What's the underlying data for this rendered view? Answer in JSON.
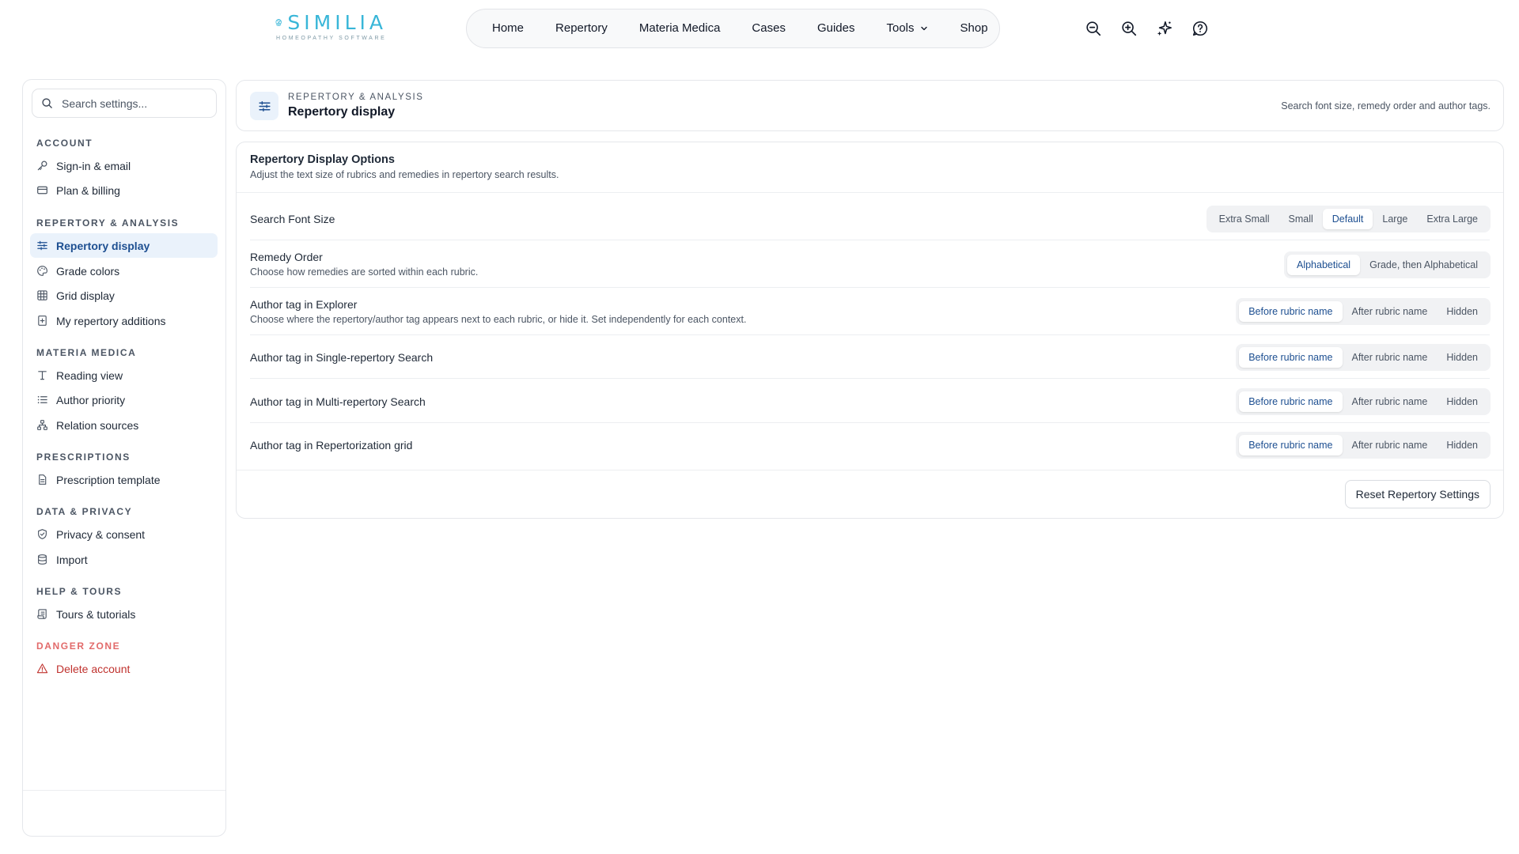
{
  "brand": {
    "name": "SIMILIA",
    "tagline": "HOMEOPATHY SOFTWARE",
    "color": "#38b6d8"
  },
  "topnav": {
    "items": [
      "Home",
      "Repertory",
      "Materia Medica",
      "Cases",
      "Guides",
      "Tools",
      "Shop"
    ],
    "tools_has_dropdown": true,
    "icons": [
      "zoom-out-icon",
      "zoom-in-icon",
      "sparkle-icon",
      "help-icon"
    ]
  },
  "sidebar": {
    "search_placeholder": "Search settings...",
    "sections": {
      "account": "ACCOUNT",
      "repertory": "REPERTORY & ANALYSIS",
      "materia": "MATERIA MEDICA",
      "prescriptions": "PRESCRIPTIONS",
      "data": "DATA & PRIVACY",
      "help": "HELP & TOURS",
      "danger": "DANGER ZONE"
    },
    "items": {
      "signin": "Sign-in & email",
      "billing": "Plan & billing",
      "repertory_display": "Repertory display",
      "grade_colors": "Grade colors",
      "grid_display": "Grid display",
      "my_additions": "My repertory additions",
      "reading_view": "Reading view",
      "author_priority": "Author priority",
      "relation_sources": "Relation sources",
      "prescription_template": "Prescription template",
      "privacy": "Privacy & consent",
      "import": "Import",
      "tours": "Tours & tutorials",
      "delete_account": "Delete account"
    },
    "active_item": "Repertory display"
  },
  "header": {
    "eyebrow": "REPERTORY & ANALYSIS",
    "title": "Repertory display",
    "hint": "Search font size, remedy order and author tags."
  },
  "options_card": {
    "title": "Repertory Display Options",
    "subtitle": "Adjust the text size of rubrics and remedies in repertory search results.",
    "rows": {
      "font_size": {
        "label": "Search Font Size",
        "options": [
          "Extra Small",
          "Small",
          "Default",
          "Large",
          "Extra Large"
        ],
        "selected": "Default"
      },
      "remedy_order": {
        "label": "Remedy Order",
        "description": "Choose how remedies are sorted within each rubric.",
        "options": [
          "Alphabetical",
          "Grade, then Alphabetical"
        ],
        "selected": "Alphabetical"
      },
      "tag_explorer": {
        "label": "Author tag in Explorer",
        "description": "Choose where the repertory/author tag appears next to each rubric, or hide it. Set independently for each context.",
        "options": [
          "Before rubric name",
          "After rubric name",
          "Hidden"
        ],
        "selected": "Before rubric name"
      },
      "tag_single": {
        "label": "Author tag in Single-repertory Search",
        "options": [
          "Before rubric name",
          "After rubric name",
          "Hidden"
        ],
        "selected": "Before rubric name"
      },
      "tag_multi": {
        "label": "Author tag in Multi-repertory Search",
        "options": [
          "Before rubric name",
          "After rubric name",
          "Hidden"
        ],
        "selected": "Before rubric name"
      },
      "tag_grid": {
        "label": "Author tag in Repertorization grid",
        "options": [
          "Before rubric name",
          "After rubric name",
          "Hidden"
        ],
        "selected": "Before rubric name"
      }
    },
    "reset_label": "Reset Repertory Settings"
  },
  "colors": {
    "accent": "#1d4f91",
    "active_bg": "#eaf2fb",
    "danger": "#c0322e",
    "danger_heading": "#e26a6a"
  }
}
